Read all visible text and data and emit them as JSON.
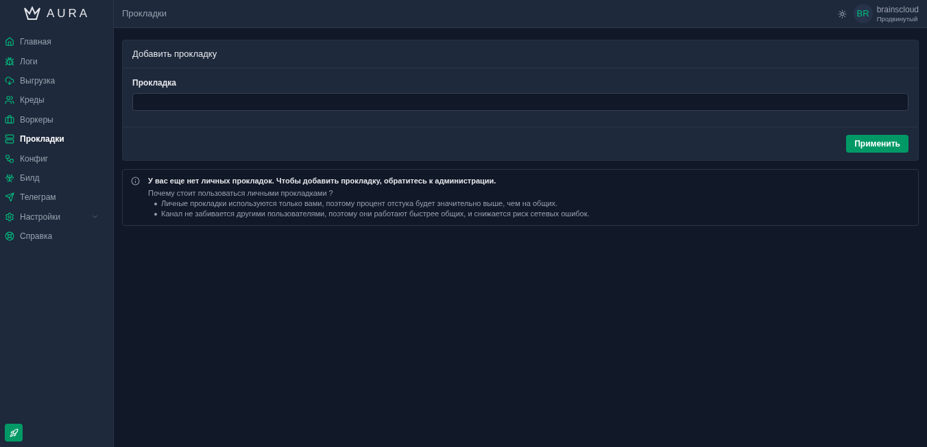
{
  "logo": {
    "text": "AURA"
  },
  "sidebar": {
    "items": [
      {
        "label": "Главная",
        "selected": false
      },
      {
        "label": "Логи",
        "selected": false
      },
      {
        "label": "Выгрузка",
        "selected": false
      },
      {
        "label": "Креды",
        "selected": false
      },
      {
        "label": "Воркеры",
        "selected": false
      },
      {
        "label": "Прокладки",
        "selected": true
      },
      {
        "label": "Конфиг",
        "selected": false
      },
      {
        "label": "Билд",
        "selected": false
      },
      {
        "label": "Телеграм",
        "selected": false
      },
      {
        "label": "Настройки",
        "selected": false,
        "expanded": false
      },
      {
        "label": "Справка",
        "selected": false
      }
    ]
  },
  "header": {
    "title": "Прокладки",
    "user": {
      "initials": "BR",
      "name": "brainscloud",
      "plan": "Продвинутый"
    }
  },
  "form": {
    "title": "Добавить прокладку",
    "field_label": "Прокладка",
    "button": "Применить"
  },
  "notice": {
    "title": "У вас еще нет личных прокладок. Чтобы добавить прокладку, обратитесь к администрации.",
    "question": "Почему стоит пользоваться личными прокладками ?",
    "points": [
      "Личные прокладки используются только вами, поэтому процент отстука будет значительно выше, чем на общих.",
      "Канал не забивается другими пользователями, поэтому они работают быстрее общих, и снижается риск сетевых ошибок."
    ]
  }
}
